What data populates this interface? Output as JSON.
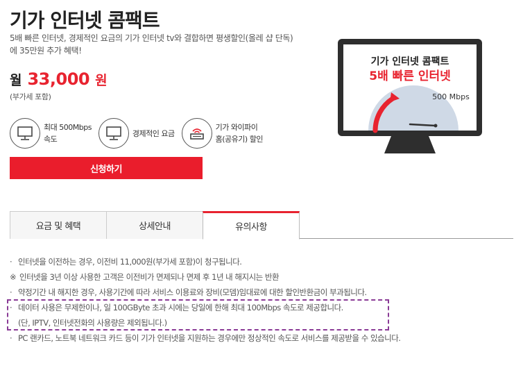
{
  "product": {
    "title": "기가 인터넷 콤팩트",
    "description": "5배 빠른 인터넷, 경제적인 요금의 기가 인터넷 tv와 결합하면 평생할인(올레 샵 단독)에 35만원 추가 혜택!"
  },
  "price": {
    "prefix": "월",
    "amount": "33,000",
    "unit": "원",
    "vat_note": "(부가세 포함)"
  },
  "features": [
    {
      "icon": "monitor-icon",
      "line1": "최대 500Mbps",
      "line2": "속도"
    },
    {
      "icon": "monitor-icon",
      "line1": "경제적인 요금",
      "line2": ""
    },
    {
      "icon": "wifi-router-icon",
      "line1": "기가 와이파이",
      "line2": "홈(공유기) 할인"
    }
  ],
  "apply_button": "신청하기",
  "tv_banner": {
    "line1": "기가 인터넷 콤팩트",
    "line2": "5배 빠른 인터넷",
    "speed": "500 Mbps"
  },
  "tabs": [
    {
      "label": "요금 및 혜택",
      "active": false
    },
    {
      "label": "상세안내",
      "active": false
    },
    {
      "label": "유의사항",
      "active": true
    }
  ],
  "notes": [
    {
      "bullet": "·",
      "text": "인터넷을 이전하는 경우, 이전비 11,000원(부가세 포함)이 청구됩니다."
    },
    {
      "bullet": "※",
      "text": "인터넷을 3년 이상 사용한 고객은 이전비가 면제되나 면제 후 1년 내 해지시는 반환"
    },
    {
      "bullet": "·",
      "text": "약정기간 내 해지한 경우, 사용기간에 따라 서비스 이용료와 장비(모뎀)임대료에 대한 할인반환금이 부과됩니다."
    },
    {
      "bullet": "·",
      "text": "데이터 사용은 무제한이나, 일 100GByte 초과 시에는 당일에 한해 최대 100Mbps 속도로 제공합니다."
    },
    {
      "bullet": "",
      "text": "(단, IPTV, 인터넷전화의 사용량은 제외됩니다.)"
    },
    {
      "bullet": "·",
      "text": "PC 랜카드, 노트북 네트워크 카드 등이 기가 인터넷을 지원하는 경우에만 정상적인 속도로 서비스를 제공받을 수 있습니다."
    }
  ],
  "colors": {
    "accent": "#e8232f",
    "highlight_border": "#8a3b96"
  }
}
